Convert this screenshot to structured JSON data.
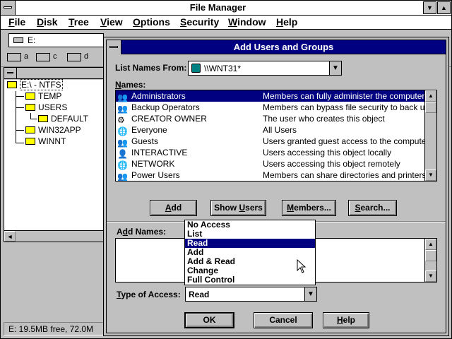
{
  "app": {
    "title": "File Manager"
  },
  "menu": [
    "File",
    "Disk",
    "Tree",
    "View",
    "Options",
    "Security",
    "Window",
    "Help"
  ],
  "menu_underline": [
    "F",
    "D",
    "T",
    "V",
    "O",
    "S",
    "W",
    "H"
  ],
  "drive_combo": {
    "value": "E:"
  },
  "drives": [
    {
      "letter": "a"
    },
    {
      "letter": "c"
    },
    {
      "letter": "d"
    }
  ],
  "tree": {
    "items": [
      {
        "label": "E:\\ - NTFS"
      },
      {
        "label": "TEMP"
      },
      {
        "label": "USERS"
      },
      {
        "label": "DEFAULT"
      },
      {
        "label": "WIN32APP"
      },
      {
        "label": "WINNT"
      }
    ]
  },
  "status": {
    "text": "E: 19.5MB free,  72.0M"
  },
  "dialog": {
    "title": "Add Users and Groups",
    "list_names_from_label": "List Names From:",
    "list_names_from_value": "\\\\WNT31*",
    "names_label": "Names:",
    "groups": [
      {
        "name": "Administrators",
        "desc": "Members can fully administer the computer/domain"
      },
      {
        "name": "Backup Operators",
        "desc": "Members can bypass file security to back up files"
      },
      {
        "name": "CREATOR OWNER",
        "desc": "The user who creates this object"
      },
      {
        "name": "Everyone",
        "desc": "All Users"
      },
      {
        "name": "Guests",
        "desc": "Users granted guest access to the computer/domain"
      },
      {
        "name": "INTERACTIVE",
        "desc": "Users accessing this object locally"
      },
      {
        "name": "NETWORK",
        "desc": "Users accessing this object remotely"
      },
      {
        "name": "Power Users",
        "desc": "Members can share directories and printers"
      }
    ],
    "buttons": {
      "add": "Add",
      "show_users": "Show Users",
      "members": "Members...",
      "search": "Search..."
    },
    "add_names_label": "Add Names:",
    "type_of_access_label": "Type of Access:",
    "type_of_access_value": "Read",
    "access_options": [
      "No Access",
      "List",
      "Read",
      "Add",
      "Add & Read",
      "Change",
      "Full Control"
    ],
    "access_selected": "Read",
    "ok": "OK",
    "cancel": "Cancel",
    "help": "Help"
  },
  "colors": {
    "titlebar_active": "#000080",
    "face": "#c0c0c0",
    "folder": "#ffff00"
  }
}
